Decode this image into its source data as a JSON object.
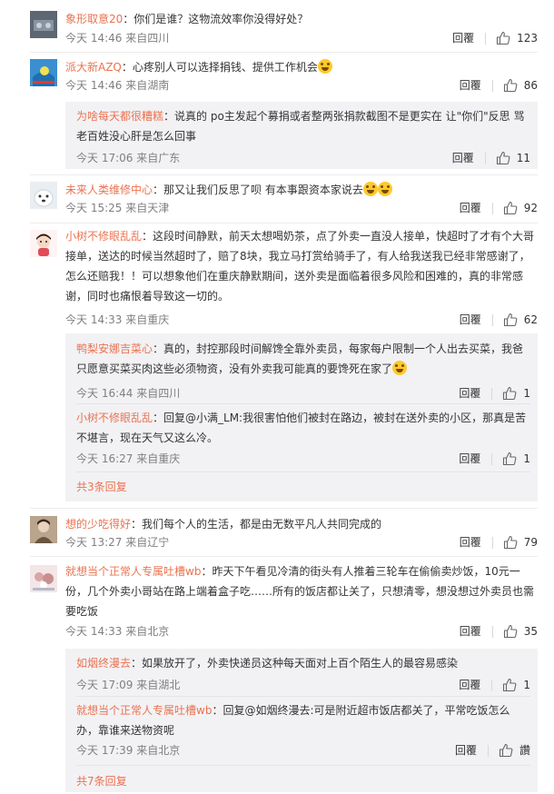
{
  "labels": {
    "reply": "回覆"
  },
  "comments": [
    {
      "name": "象形取意20",
      "text": "：你们是谁？这物流效率你没得好处？",
      "time": "今天 14:46 来自四川",
      "likes": "123"
    },
    {
      "name": "派大新AZQ",
      "text": "：心疼别人可以选择捐钱、提供工作机会",
      "time": "今天 14:46 来自湖南",
      "likes": "86",
      "replies": [
        {
          "name": "为啥每天都很糟糕",
          "text": "：说真的 po主发起个募捐或者整两张捐款截图不是更实在 让\"你们\"反思 骂老百姓没心肝是怎么回事",
          "time": "今天 17:06 来自广东",
          "likes": "11"
        }
      ]
    },
    {
      "name": "未来人类维修中心",
      "text": "：那又让我们反思了呗 有本事跟资本家说去",
      "time": "今天 15:25 来自天津",
      "likes": "92"
    },
    {
      "name": "小树不修眼乱乱",
      "text": "：这段时间静默，前天太想喝奶茶，点了外卖一直没人接单，快超时了才有个大哥接单，送达的时候当然超时了，赔了8块，我立马打赏给骑手了，有人给我送我已经非常感谢了，怎么还赔我！！可以想象他们在重庆静默期间，送外卖是面临着很多风险和困难的，真的非常感谢，同时也痛恨着导致这一切的。",
      "time": "今天 14:33 来自重庆",
      "likes": "62",
      "replies": [
        {
          "name": "鸭梨安娜吉菜心",
          "text": "：真的，封控那段时间解馋全靠外卖员，每家每户限制一个人出去买菜，我爸只愿意买菜买肉这些必须物资，没有外卖我可能真的要馋死在家了",
          "time": "今天 16:44 来自四川",
          "likes": "1"
        },
        {
          "name": "小树不修眼乱乱",
          "text": "：回复@小满_LM:我很害怕他们被封在路边，被封在送外卖的小区，那真是苦不堪言，现在天气又这么冷。",
          "time": "今天 16:27 来自重庆",
          "likes": "1"
        }
      ],
      "more": "共3条回复"
    },
    {
      "name": "想的少吃得好",
      "text": "：我们每个人的生活，都是由无数平凡人共同完成的",
      "time": "今天 13:27 来自辽宁",
      "likes": "79"
    },
    {
      "name": "就想当个正常人专属吐槽wb",
      "text": "：昨天下午看见冷清的街头有人推着三轮车在偷偷卖炒饭，10元一份，几个外卖小哥站在路上端着盒子吃……所有的饭店都让关了，只想清零，想没想过外卖员也需要吃饭",
      "time": "今天 14:33 来自北京",
      "likes": "35",
      "replies": [
        {
          "name": "如烟终漫去",
          "text": "：如果放开了，外卖快递员这种每天面对上百个陌生人的最容易感染",
          "time": "今天 17:09 来自湖北",
          "likes": "1"
        },
        {
          "name": "就想当个正常人专属吐槽wb",
          "text": "：回复@如烟终漫去:可是附近超市饭店都关了，平常吃饭怎么办，靠谁来送物资呢",
          "time": "今天 17:39 来自北京",
          "likes": "讚"
        }
      ],
      "more": "共7条回复"
    }
  ]
}
